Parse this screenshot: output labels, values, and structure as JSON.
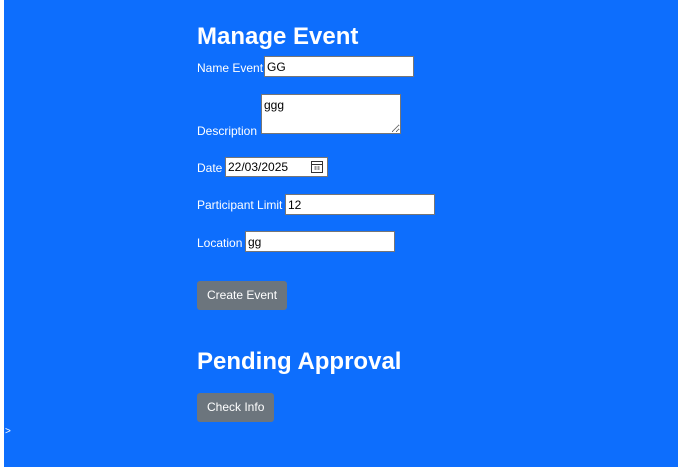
{
  "manage": {
    "title": "Manage Event",
    "name_label": "Name Event",
    "name_value": "GG",
    "description_label": "Description",
    "description_value": "ggg",
    "date_label": "Date",
    "date_value": "22/03/2025",
    "limit_label": "Participant Limit",
    "limit_value": "12",
    "location_label": "Location",
    "location_value": "gg",
    "create_button": "Create Event"
  },
  "pending": {
    "title": "Pending Approval",
    "check_button": "Check Info"
  },
  "misc": {
    "caret": ">"
  },
  "colors": {
    "page_bg": "#0d6efd",
    "button_bg": "#6c757d",
    "text": "#ffffff"
  },
  "icons": {
    "date_picker": "calendar-icon"
  }
}
